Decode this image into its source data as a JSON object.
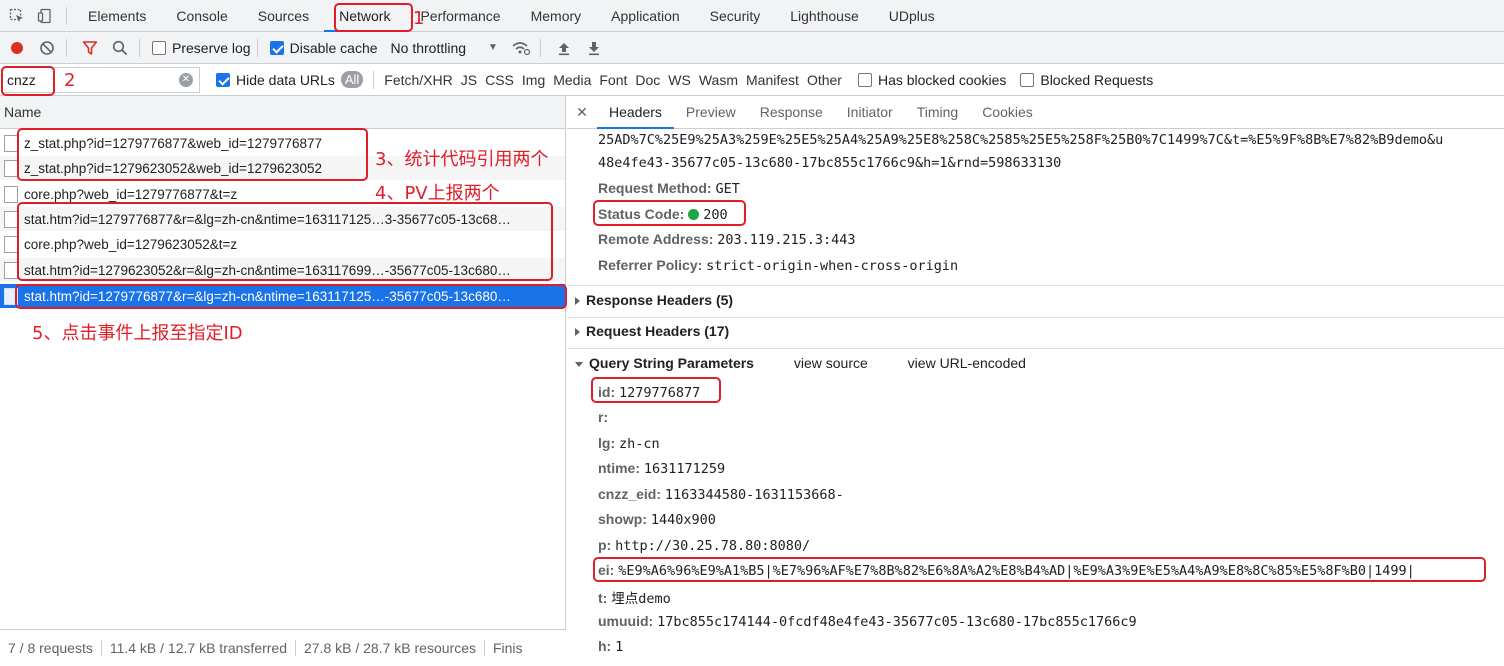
{
  "tabs": [
    "Elements",
    "Console",
    "Sources",
    "Network",
    "Performance",
    "Memory",
    "Application",
    "Security",
    "Lighthouse",
    "UDplus"
  ],
  "toolbar": {
    "preserve_log": "Preserve log",
    "disable_cache": "Disable cache",
    "throttling": "No throttling"
  },
  "filter": {
    "value": "cnzz",
    "hide_data_urls": "Hide data URLs",
    "all": "All",
    "types": [
      "Fetch/XHR",
      "JS",
      "CSS",
      "Img",
      "Media",
      "Font",
      "Doc",
      "WS",
      "Wasm",
      "Manifest",
      "Other"
    ],
    "has_blocked_cookies": "Has blocked cookies",
    "blocked_requests": "Blocked Requests"
  },
  "requests": {
    "header": "Name",
    "rows": [
      "z_stat.php?id=1279776877&web_id=1279776877",
      "z_stat.php?id=1279623052&web_id=1279623052",
      "core.php?web_id=1279776877&t=z",
      "stat.htm?id=1279776877&r=&lg=zh-cn&ntime=163117125…3-35677c05-13c68…",
      "core.php?web_id=1279623052&t=z",
      "stat.htm?id=1279623052&r=&lg=zh-cn&ntime=163117699…-35677c05-13c680…",
      "stat.htm?id=1279776877&r=&lg=zh-cn&ntime=163117125…-35677c05-13c680…"
    ]
  },
  "footer": {
    "requests": "7 / 8 requests",
    "transferred": "11.4 kB / 12.7 kB transferred",
    "resources": "27.8 kB / 28.7 kB resources",
    "finish": "Finis"
  },
  "detail": {
    "tabs": [
      "Headers",
      "Preview",
      "Response",
      "Initiator",
      "Timing",
      "Cookies"
    ],
    "url_line1": "25AD%7C%25E9%25A3%259E%25E5%25A4%25A9%25E8%258C%2585%25E5%258F%25B0%7C1499%7C&t=%E5%9F%8B%E7%82%B9demo&u",
    "url_line2": "48e4fe43-35677c05-13c680-17bc855c1766c9&h=1&rnd=598633130",
    "general": {
      "method_k": "Request Method:",
      "method_v": "GET",
      "status_k": "Status Code:",
      "status_v": "200",
      "remote_k": "Remote Address:",
      "remote_v": "203.119.215.3:443",
      "referrer_k": "Referrer Policy:",
      "referrer_v": "strict-origin-when-cross-origin"
    },
    "response_headers": "Response Headers (5)",
    "request_headers": "Request Headers (17)",
    "qsp": "Query String Parameters",
    "view_source": "view source",
    "view_url_encoded": "view URL-encoded",
    "params": [
      {
        "k": "id:",
        "v": "1279776877"
      },
      {
        "k": "r:",
        "v": ""
      },
      {
        "k": "lg:",
        "v": "zh-cn"
      },
      {
        "k": "ntime:",
        "v": "1631171259"
      },
      {
        "k": "cnzz_eid:",
        "v": "1163344580-1631153668-"
      },
      {
        "k": "showp:",
        "v": "1440x900"
      },
      {
        "k": "p:",
        "v": "http://30.25.78.80:8080/"
      },
      {
        "k": "ei:",
        "v": "%E9%A6%96%E9%A1%B5|%E7%96%AF%E7%8B%82%E6%8A%A2%E8%B4%AD|%E9%A3%9E%E5%A4%A9%E8%8C%85%E5%8F%B0|1499|"
      },
      {
        "k": "t:",
        "v": "埋点demo"
      },
      {
        "k": "umuuid:",
        "v": "17bc855c174144-0fcdf48e4fe43-35677c05-13c680-17bc855c1766c9"
      },
      {
        "k": "h:",
        "v": "1"
      }
    ]
  },
  "annotations": {
    "a1": "1",
    "a2": "2",
    "a3": "3、统计代码引用两个",
    "a4": "4、PV上报两个",
    "a5": "5、点击事件上报至指定ID"
  },
  "colors": {
    "annotation_red": "#e01e2a",
    "selected_blue": "#1a73e8",
    "record_red": "#d93025"
  }
}
